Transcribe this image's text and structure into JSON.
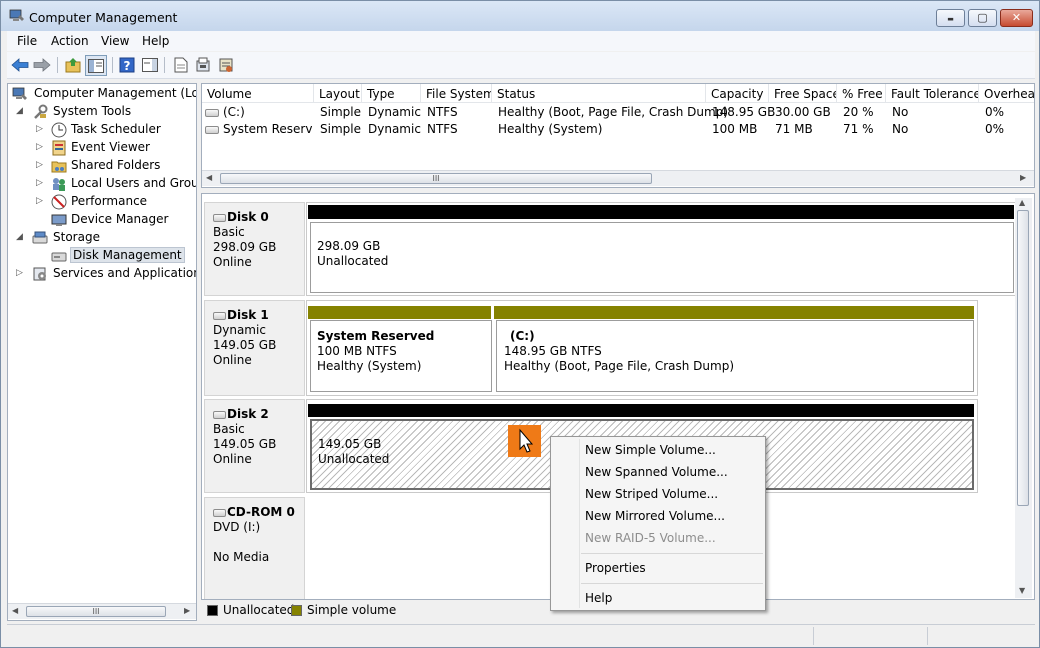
{
  "window": {
    "title": "Computer Management",
    "buttons": {
      "minimize": "▬",
      "maximize": "▢",
      "close": "✕"
    }
  },
  "menubar": {
    "items": [
      "File",
      "Action",
      "View",
      "Help"
    ]
  },
  "toolbar": {
    "icons": [
      "back-arrow-icon",
      "forward-arrow-icon",
      "up-folder-icon",
      "show-hide-tree-icon",
      "help-icon",
      "action-pane-icon",
      "rescan-disks-icon",
      "properties-icon",
      "export-list-icon"
    ]
  },
  "tree": {
    "nodes": [
      {
        "label": "Computer Management (Local",
        "icon": "computer-management-icon"
      },
      {
        "label": "System Tools",
        "icon": "system-tools-icon"
      },
      {
        "label": "Task Scheduler",
        "icon": "clock-icon"
      },
      {
        "label": "Event Viewer",
        "icon": "event-viewer-icon"
      },
      {
        "label": "Shared Folders",
        "icon": "shared-folder-icon"
      },
      {
        "label": "Local Users and Groups",
        "icon": "users-icon"
      },
      {
        "label": "Performance",
        "icon": "performance-icon"
      },
      {
        "label": "Device Manager",
        "icon": "device-manager-icon"
      },
      {
        "label": "Storage",
        "icon": "storage-icon"
      },
      {
        "label": "Disk Management",
        "icon": "disk-management-icon"
      },
      {
        "label": "Services and Applications",
        "icon": "services-icon"
      }
    ],
    "scroll_thumb": "III"
  },
  "volumes": {
    "columns": [
      "Volume",
      "Layout",
      "Type",
      "File System",
      "Status",
      "Capacity",
      "Free Space",
      "% Free",
      "Fault Tolerance",
      "Overhead"
    ],
    "rows": [
      [
        "(C:)",
        "Simple",
        "Dynamic",
        "NTFS",
        "Healthy (Boot, Page File, Crash Dump)",
        "148.95 GB",
        "30.00 GB",
        "20 %",
        "No",
        "0%"
      ],
      [
        "System Reserved",
        "Simple",
        "Dynamic",
        "NTFS",
        "Healthy (System)",
        "100 MB",
        "71 MB",
        "71 %",
        "No",
        "0%"
      ]
    ],
    "scroll_thumb": "III"
  },
  "disks": [
    {
      "name": "Disk 0",
      "kind": "Basic",
      "size": "298.09 GB",
      "state": "Online",
      "partitions": [
        {
          "name": "",
          "size": "298.09 GB",
          "status": "Unallocated"
        }
      ]
    },
    {
      "name": "Disk 1",
      "kind": "Dynamic",
      "size": "149.05 GB",
      "state": "Online",
      "partitions": [
        {
          "name": "System Reserved",
          "size": "100 MB NTFS",
          "status": "Healthy (System)"
        },
        {
          "name": "(C:)",
          "size": "148.95 GB NTFS",
          "status": "Healthy (Boot, Page File, Crash Dump)"
        }
      ]
    },
    {
      "name": "Disk 2",
      "kind": "Basic",
      "size": "149.05 GB",
      "state": "Online",
      "partitions": [
        {
          "name": "",
          "size": "149.05 GB",
          "status": "Unallocated"
        }
      ]
    },
    {
      "name": "CD-ROM 0",
      "kind": "DVD (I:)",
      "size": "",
      "state": "No Media",
      "partitions": []
    }
  ],
  "legend": {
    "unallocated": "Unallocated",
    "simple": "Simple volume"
  },
  "colors": {
    "unallocated": "#000000",
    "simple_volume": "#858200",
    "cursor_highlight": "#ef7a17"
  },
  "context_menu": {
    "items": [
      {
        "label": "New Simple Volume...",
        "enabled": true
      },
      {
        "label": "New Spanned Volume...",
        "enabled": true
      },
      {
        "label": "New Striped Volume...",
        "enabled": true
      },
      {
        "label": "New Mirrored Volume...",
        "enabled": true
      },
      {
        "label": "New RAID-5 Volume...",
        "enabled": false
      },
      {
        "label": "Properties",
        "enabled": true
      },
      {
        "label": "Help",
        "enabled": true
      }
    ]
  }
}
